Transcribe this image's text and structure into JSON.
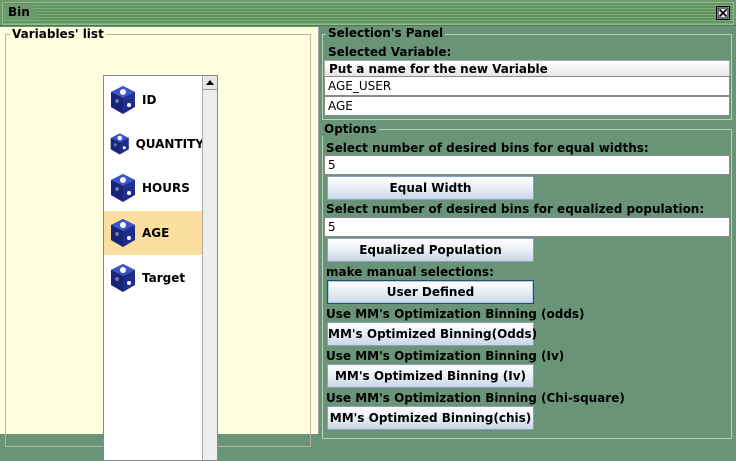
{
  "window": {
    "title": "Bin"
  },
  "variables": {
    "legend": "Variables' list",
    "items": [
      {
        "label": "ID",
        "selected": false
      },
      {
        "label": "QUANTITY",
        "selected": false
      },
      {
        "label": "HOURS",
        "selected": false
      },
      {
        "label": "AGE",
        "selected": true
      },
      {
        "label": "Target",
        "selected": false
      }
    ]
  },
  "selection": {
    "legend": "Selection's Panel",
    "selected_variable_label": "Selected Variable:",
    "new_name_header": "Put a name for the new Variable",
    "new_name_value": "AGE_USER",
    "variable_value": "AGE"
  },
  "options": {
    "legend": "Options",
    "equal_width_label": "Select number of desired bins for equal widths:",
    "equal_width_value": "5",
    "equal_width_button": "Equal Width",
    "equalized_label": "Select number of desired bins for equalized population:",
    "equalized_value": "5",
    "equalized_button": "Equalized Population",
    "manual_label": "make manual selections:",
    "manual_button": "User Defined",
    "odds_label": "Use MM's Optimization Binning (odds)",
    "odds_button": "MM's Optimized Binning(Odds)",
    "iv_label": "Use MM's Optimization Binning (Iv)",
    "iv_button": "MM's Optimized Binning  (Iv)",
    "chi_label": "Use MM's Optimization Binning (Chi-square)",
    "chi_button": "MM's Optimized Binning(chis)"
  },
  "colors": {
    "panel_bg": "#6a9477",
    "list_bg": "#ffffe0",
    "selected_row": "#fbdfa0"
  },
  "icons": {
    "variable": "variable-cube-icon",
    "close": "close-icon",
    "scroll_up": "scroll-up-arrow-icon"
  }
}
